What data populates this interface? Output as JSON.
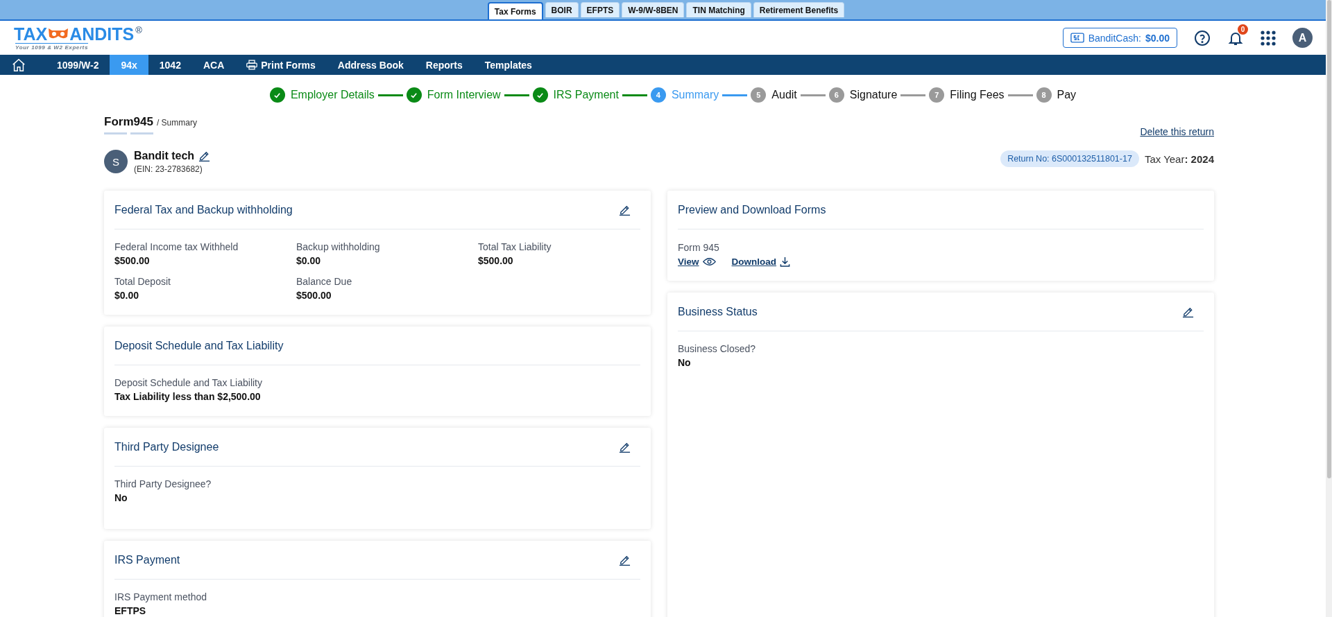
{
  "top_tabs": [
    {
      "label": "Tax Forms",
      "selected": true
    },
    {
      "label": "BOIR",
      "selected": false
    },
    {
      "label": "EFPTS",
      "selected": false
    },
    {
      "label": "W-9/W-8BEN",
      "selected": false
    },
    {
      "label": "TIN Matching",
      "selected": false
    },
    {
      "label": "Retirement Benefits",
      "selected": false
    }
  ],
  "logo": {
    "left": "TAX",
    "right": "ANDITS",
    "mark": "®",
    "tagline": "Your 1099 & W2 Experts"
  },
  "bandit_cash": {
    "label": "BanditCash:",
    "amount": "$0.00"
  },
  "notifications": {
    "count": "0"
  },
  "avatar": {
    "initial": "A"
  },
  "nav": [
    {
      "kind": "home",
      "selected": false
    },
    {
      "kind": "text",
      "label": "1099/W-2",
      "selected": false
    },
    {
      "kind": "text",
      "label": "94x",
      "selected": true
    },
    {
      "kind": "text",
      "label": "1042",
      "selected": false
    },
    {
      "kind": "text",
      "label": "ACA",
      "selected": false
    },
    {
      "kind": "print",
      "label": "Print Forms",
      "selected": false
    },
    {
      "kind": "text",
      "label": "Address Book",
      "selected": false
    },
    {
      "kind": "text",
      "label": "Reports",
      "selected": false
    },
    {
      "kind": "text",
      "label": "Templates",
      "selected": false
    }
  ],
  "steps": [
    {
      "label": "Employer Details",
      "completed": true,
      "selected": false
    },
    {
      "label": "Form Interview",
      "completed": true,
      "selected": false
    },
    {
      "label": "IRS Payment",
      "completed": true,
      "selected": false
    },
    {
      "number": "4",
      "label": "Summary",
      "completed": false,
      "selected": true
    },
    {
      "number": "5",
      "label": "Audit",
      "completed": false,
      "selected": false
    },
    {
      "number": "6",
      "label": "Signature",
      "completed": false,
      "selected": false
    },
    {
      "number": "7",
      "label": "Filing Fees",
      "completed": false,
      "selected": false
    },
    {
      "number": "8",
      "label": "Pay",
      "completed": false,
      "selected": false
    }
  ],
  "page": {
    "form": "Form945",
    "crumb": "/ Summary",
    "delete_link": "Delete this return"
  },
  "payer": {
    "initial": "S",
    "name": "Bandit tech",
    "ein": "(EIN: 23-2783682)",
    "return_no": "Return No: 6S000132511801-17",
    "tax_year": "Tax Year**: 2024**"
  },
  "left_cards": [
    {
      "kind": "fields",
      "title": "Federal Tax and Backup withholding",
      "editable": true,
      "fields": [
        {
          "label": "Federal Income tax Withheld",
          "value": "$500.00"
        },
        {
          "label": "Backup withholding",
          "value": "$0.00"
        },
        {
          "label": "Total Tax Liability",
          "value": "$500.00"
        },
        {
          "label": "Total Deposit",
          "value": "$0.00"
        },
        {
          "label": "Balance Due",
          "value": "$500.00"
        }
      ]
    },
    {
      "kind": "fields",
      "title": "Deposit Schedule and Tax Liability",
      "editable": false,
      "fields": [
        {
          "label": "Deposit Schedule and Tax Liability",
          "value": "Tax Liability less than $2,500.00"
        }
      ]
    },
    {
      "kind": "fields",
      "title": "Third Party Designee",
      "editable": true,
      "fields": [
        {
          "label": "Third Party Designee?",
          "value": "No"
        }
      ]
    },
    {
      "kind": "fields",
      "title": "IRS Payment",
      "editable": true,
      "fields": [
        {
          "label": "IRS Payment method",
          "value": "EFTPS"
        }
      ]
    }
  ],
  "right_cards": [
    {
      "kind": "downloads",
      "title": "Preview and Download Forms",
      "editable": false,
      "form": "Form 945",
      "view": "View",
      "download": "Download"
    },
    {
      "kind": "fields",
      "title": "Business Status",
      "editable": true,
      "fields": [
        {
          "label": "Business Closed?",
          "value": "No"
        }
      ]
    }
  ]
}
